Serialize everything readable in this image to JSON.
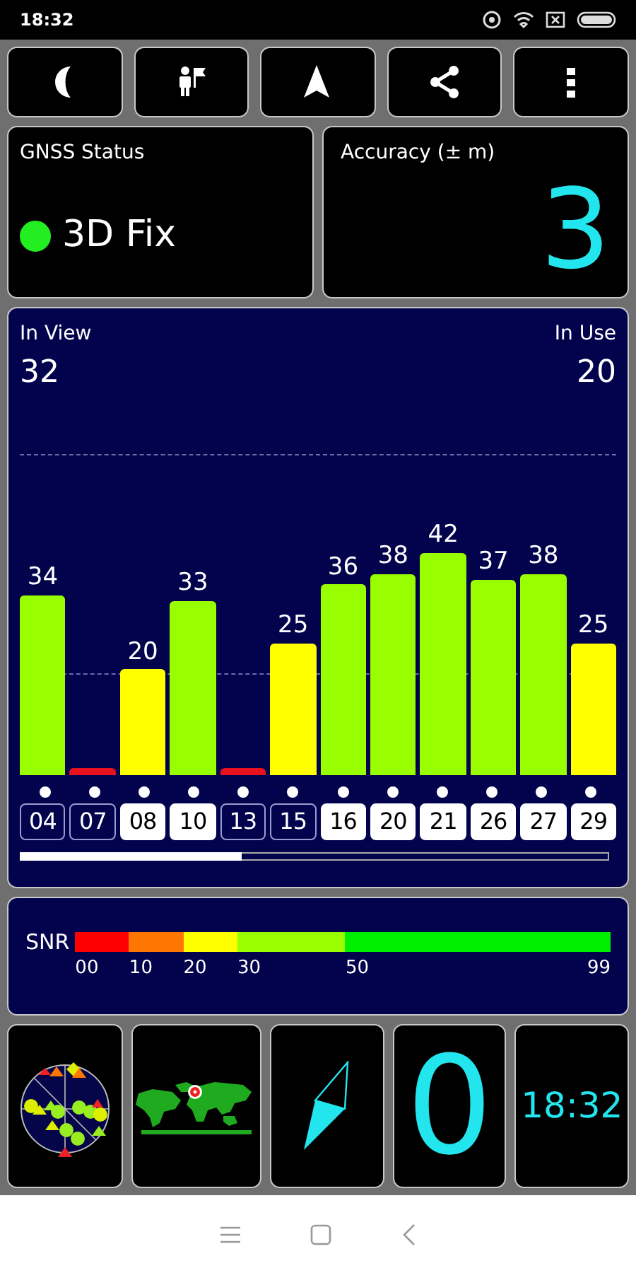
{
  "status_bar": {
    "time": "18:32"
  },
  "toolbar": [
    {
      "kind": "moon"
    },
    {
      "kind": "guide"
    },
    {
      "kind": "navigate"
    },
    {
      "kind": "share"
    },
    {
      "kind": "more"
    }
  ],
  "gnss_status": {
    "title": "GNSS Status",
    "fix": "3D Fix",
    "color": "#22ee22"
  },
  "accuracy": {
    "title": "Accuracy (± m)",
    "value": "3"
  },
  "signal_chart": {
    "in_view_label": "In View",
    "in_view": "32",
    "in_use_label": "In Use",
    "in_use": "20",
    "satellites": [
      {
        "id": "04",
        "snr": "34",
        "color": "#99ff00",
        "used": false
      },
      {
        "id": "07",
        "color": "#e8121e",
        "used": false
      },
      {
        "id": "08",
        "snr": "20",
        "color": "#ffff00",
        "used": true
      },
      {
        "id": "10",
        "snr": "33",
        "color": "#99ff00",
        "used": true
      },
      {
        "id": "13",
        "color": "#e8121e",
        "used": false
      },
      {
        "id": "15",
        "snr": "25",
        "color": "#ffff00",
        "used": false
      },
      {
        "id": "16",
        "snr": "36",
        "color": "#99ff00",
        "used": true
      },
      {
        "id": "20",
        "snr": "38",
        "color": "#99ff00",
        "used": true
      },
      {
        "id": "21",
        "snr": "42",
        "color": "#99ff00",
        "used": true
      },
      {
        "id": "26",
        "snr": "37",
        "color": "#99ff00",
        "used": true
      },
      {
        "id": "27",
        "snr": "38",
        "color": "#99ff00",
        "used": true
      },
      {
        "id": "29",
        "snr": "25",
        "color": "#ffff00",
        "used": true
      }
    ]
  },
  "snr_legend": {
    "label": "SNR",
    "ticks": [
      "00",
      "10",
      "20",
      "30",
      "50",
      "99"
    ],
    "segments": [
      {
        "color": "#ff0000"
      },
      {
        "color": "#ff7700"
      },
      {
        "color": "#ffff00"
      },
      {
        "color": "#99ff00"
      },
      {
        "color": "#00ee00"
      }
    ]
  },
  "tiles": [
    {
      "kind": "sky"
    },
    {
      "kind": "map"
    },
    {
      "kind": "compass"
    },
    {
      "kind": "speed",
      "value": "0"
    },
    {
      "kind": "clock",
      "value": "18:32"
    }
  ]
}
